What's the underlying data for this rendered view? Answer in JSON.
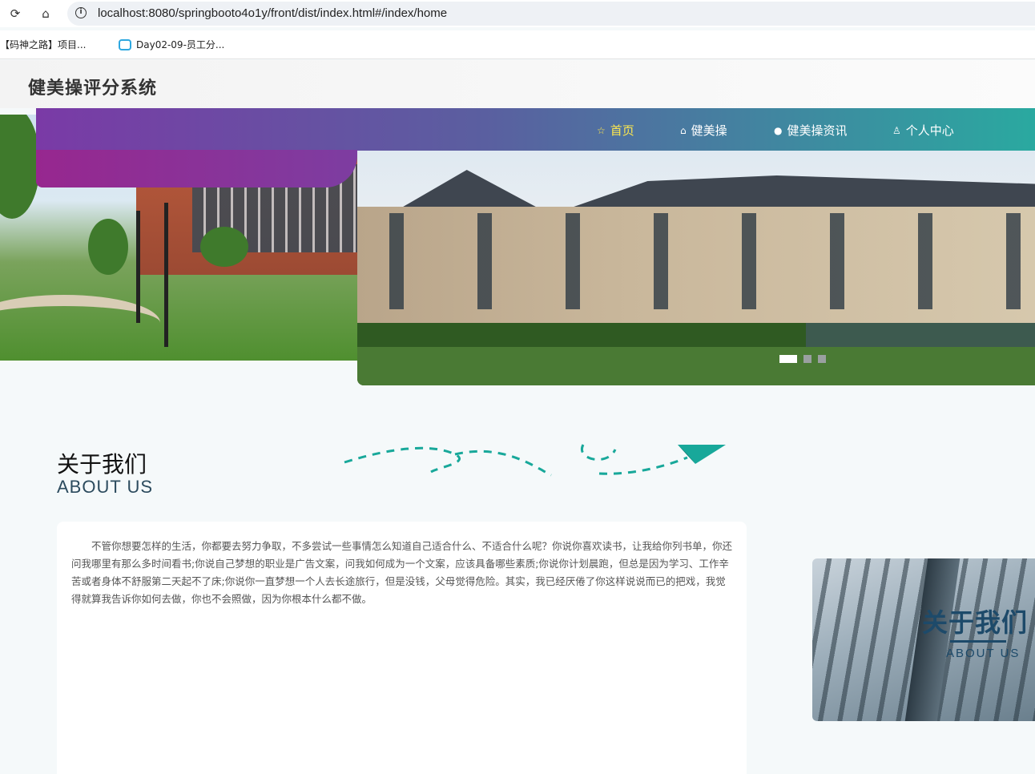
{
  "browser": {
    "url": "localhost:8080/springbooto4o1y/front/dist/index.html#/index/home",
    "bookmarks": [
      "【码神之路】项目...",
      "Day02-09-员工分..."
    ]
  },
  "site": {
    "title": "健美操评分系统"
  },
  "nav": {
    "items": [
      {
        "label": "首页",
        "icon": "star-icon",
        "active": true
      },
      {
        "label": "健美操",
        "icon": "bag-icon",
        "active": false
      },
      {
        "label": "健美操资讯",
        "icon": "info-icon",
        "active": false
      },
      {
        "label": "个人中心",
        "icon": "user-icon",
        "active": false
      }
    ]
  },
  "carousel": {
    "slide_count": 3,
    "active_index": 0
  },
  "about": {
    "title_zh": "关于我们",
    "title_en": "ABOUT US",
    "body": "不管你想要怎样的生活，你都要去努力争取，不多尝试一些事情怎么知道自己适合什么、不适合什么呢？你说你喜欢读书，让我给你列书单，你还问我哪里有那么多时间看书;你说自己梦想的职业是广告文案，问我如何成为一个文案，应该具备哪些素质;你说你计划晨跑，但总是因为学习、工作辛苦或者身体不舒服第二天起不了床;你说你一直梦想一个人去长途旅行，但是没钱，父母觉得危险。其实，我已经厌倦了你这样说说而已的把戏，我觉得就算我告诉你如何去做，你也不会照做，因为你根本什么都不做。",
    "image_title_zh": "关于我们",
    "image_title_en": "ABOUT US"
  },
  "colors": {
    "nav_active": "#ffe94d",
    "nav_gradient_start": "#7a3aa6",
    "nav_gradient_end": "#2aa9a0",
    "accent_teal": "#18a89a"
  }
}
